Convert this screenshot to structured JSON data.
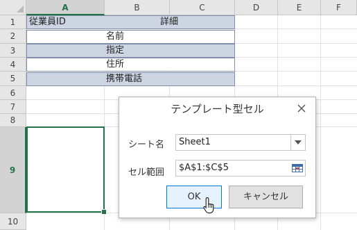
{
  "sheet": {
    "columns": [
      "A",
      "B",
      "C",
      "D",
      "E",
      "F"
    ],
    "selected_column": "A",
    "rows": [
      "1",
      "2",
      "3",
      "4",
      "5",
      "6",
      "7",
      "8",
      "9",
      "10"
    ],
    "selected_row": "9",
    "table": {
      "header_left": "従業員ID",
      "header_right": "詳細",
      "rows": [
        "名前",
        "指定",
        "住所",
        "携帯電話"
      ]
    }
  },
  "dialog": {
    "title": "テンプレート型セル",
    "sheet_name_label": "シート名",
    "sheet_name_value": "Sheet1",
    "range_label": "セル範囲",
    "range_value": "$A$1:$C$5",
    "ok_label": "OK",
    "cancel_label": "キャンセル"
  },
  "colors": {
    "accent": "#217346",
    "table_fill": "#cdd5e2",
    "ok_border": "#0078d7"
  },
  "icons": {
    "close": "close-icon",
    "dropdown": "chevron-down-icon",
    "range": "range-select-icon",
    "cursor": "hand-pointer-icon"
  }
}
